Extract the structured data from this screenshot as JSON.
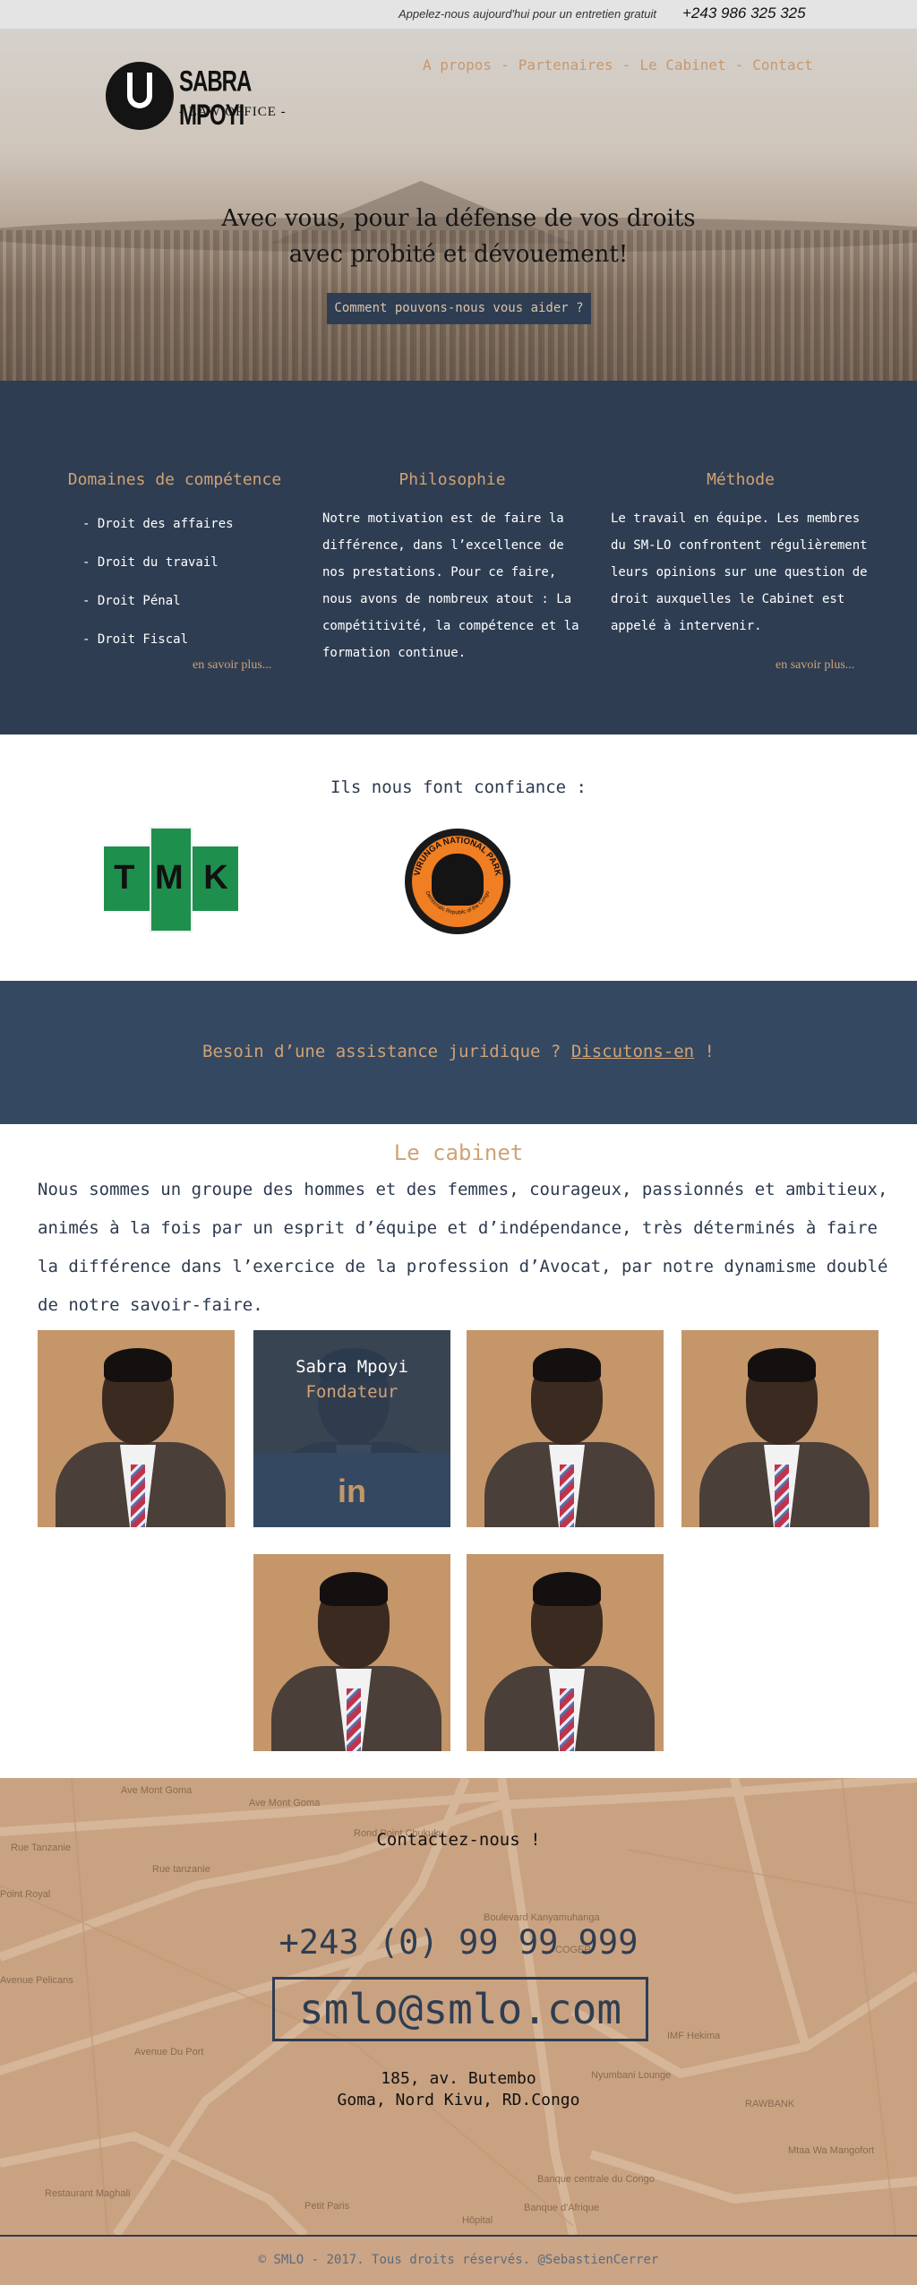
{
  "topbar": {
    "text": "Appelez-nous aujourd'hui pour un entretien gratuit",
    "phone": "+243 986 325 325"
  },
  "brand": {
    "name": "SABRA MPOYI",
    "subtitle": "- LAW OFFICE -"
  },
  "nav": {
    "items": [
      "A propos",
      "Partenaires",
      "Le Cabinet",
      "Contact"
    ],
    "separator": "-"
  },
  "hero": {
    "title_line1": "Avec vous, pour la défense de vos droits",
    "title_line2": "avec probité et dévouement!",
    "button": "Comment pouvons-nous vous aider ?"
  },
  "features": {
    "domains": {
      "title": "Domaines de compétence",
      "items": [
        "- Droit des affaires",
        "- Droit du travail",
        "- Droit Pénal",
        "- Droit Fiscal"
      ],
      "more": "en savoir plus..."
    },
    "philosophy": {
      "title": "Philosophie",
      "text": "Notre motivation est de faire la différence, dans l’excellence de nos prestations. Pour ce faire, nous avons de nombreux atout : La compétitivité, la compétence et la formation continue."
    },
    "method": {
      "title": "Méthode",
      "text": "Le travail en équipe. Les membres du SM-LO confrontent régulièrement leurs opinions sur une question de droit auxquelles le Cabinet est appelé à intervenir.",
      "more": "en savoir plus..."
    }
  },
  "trust": {
    "title": "Ils nous font confiance :",
    "logos": [
      {
        "name": "TMK",
        "letters": [
          "T",
          "M",
          "K"
        ],
        "color": "#1f8f4e"
      },
      {
        "name": "VIRUNGA NATIONAL PARK",
        "subtext": "Democratic Republic of the Congo",
        "color": "#f07e22"
      }
    ]
  },
  "cta": {
    "text": "Besoin d’une assistance juridique ? ",
    "link": "Discutons-en",
    "suffix": " !"
  },
  "cabinet": {
    "title": "Le cabinet",
    "text": "Nous sommes un groupe des hommes et des femmes, courageux, passionnés et ambitieux, animés à la fois par un esprit d’équipe et d’indépendance, très déterminés à faire la différence dans l’exercice de la profession d’Avocat, par notre dynamisme doublé de notre savoir-faire.",
    "featured": {
      "name": "Sabra Mpoyi",
      "role": "Fondateur",
      "social": "in"
    }
  },
  "contact": {
    "title": "Contactez-nous !",
    "phone": "+243 (0) 99 99 999",
    "email": "smlo@smlo.com",
    "address_line1": "185, av. Butembo",
    "address_line2": "Goma, Nord Kivu, RD.Congo",
    "map_labels": [
      "Ave Mont Goma",
      "Ave Mont Goma",
      "Rond Point Chukuku",
      "Rue Tanzanie",
      "Rue tanzanie",
      "Point Royal",
      "Avenue Pelicans",
      "Avenue Du Port",
      "Restaurant Maghali",
      "Petit Paris",
      "Hôpital",
      "Banque centrale du Congo",
      "Banque d'Afrique",
      "IMF Hekima",
      "Nyumbani Lounge",
      "RAWBANK",
      "Mtaa Wa Mangofort",
      "Boulevard Kanyamuhanga",
      "COGEP"
    ]
  },
  "footer": {
    "text": "© SMLO - 2017. Tous droits réservés. @SebastienCerrer"
  },
  "colors": {
    "navy": "#2e3d52",
    "accent": "#d0a276",
    "map": "#c9a281"
  }
}
